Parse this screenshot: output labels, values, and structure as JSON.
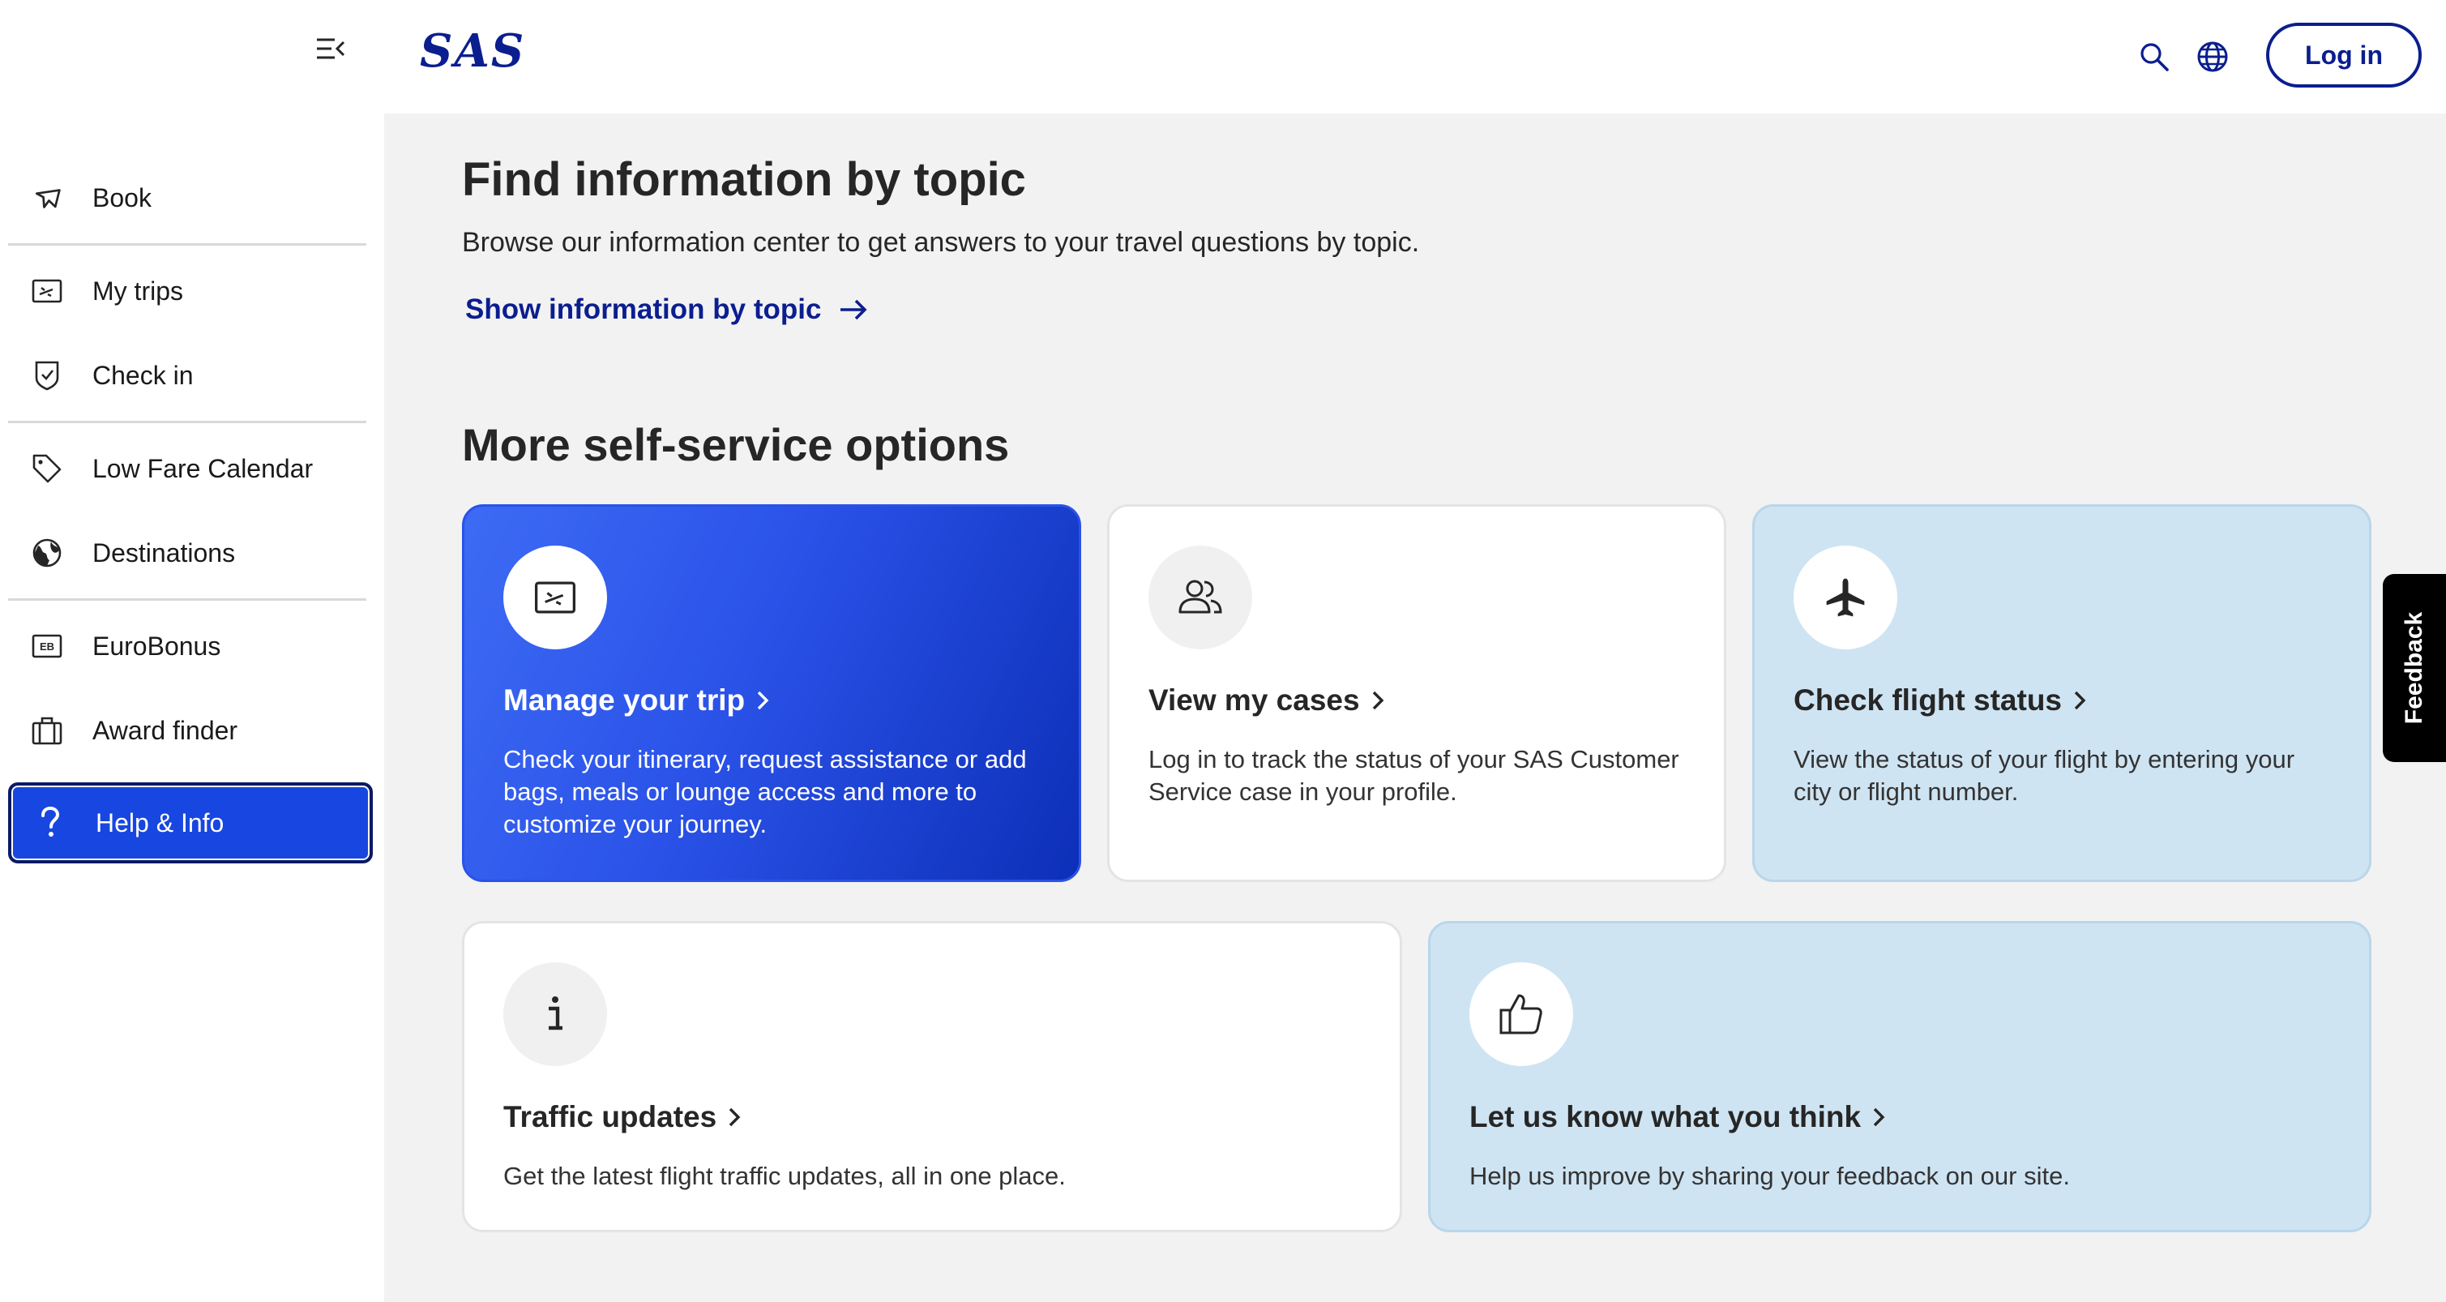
{
  "header": {
    "logo_text": "SAS",
    "login_label": "Log in",
    "icons": [
      "search-icon",
      "globe-icon"
    ]
  },
  "sidebar": {
    "collapse_icon": "menu-collapse-icon",
    "items": [
      {
        "label": "Book",
        "icon": "plane-icon"
      },
      {
        "label": "My trips",
        "icon": "ticket-icon"
      },
      {
        "label": "Check in",
        "icon": "shield-check-icon"
      },
      {
        "label": "Low Fare Calendar",
        "icon": "tag-icon"
      },
      {
        "label": "Destinations",
        "icon": "globe-icon"
      },
      {
        "label": "EuroBonus",
        "icon": "eb-card-icon"
      },
      {
        "label": "Award finder",
        "icon": "briefcase-icon"
      },
      {
        "label": "Help & Info",
        "icon": "question-icon",
        "active": true
      }
    ]
  },
  "main": {
    "heading": "Find information by topic",
    "description": "Browse our information center to get answers to your travel questions by topic.",
    "topic_link": "Show information by topic",
    "self_service_heading": "More self-service options",
    "cards": [
      {
        "title": "Manage your trip",
        "text": "Check your itinerary, request assistance or add bags, meals or lounge access and more to customize your journey.",
        "icon": "ticket-icon",
        "style": "blue-gradient"
      },
      {
        "title": "View my cases",
        "text": "Log in to track the status of your SAS Customer Service case in your profile.",
        "icon": "users-icon",
        "style": "white"
      },
      {
        "title": "Check flight status",
        "text": "View the status of your flight by entering your city or flight number.",
        "icon": "plane-icon",
        "style": "light-blue"
      },
      {
        "title": "Traffic updates",
        "text": "Get the latest flight traffic updates, all in one place.",
        "icon": "info-icon",
        "style": "white"
      },
      {
        "title": "Let us know what you think",
        "text": "Help us improve by sharing your feedback on our site.",
        "icon": "thumbs-up-icon",
        "style": "light-blue"
      }
    ]
  },
  "feedback_tab": "Feedback",
  "colors": {
    "brand_navy": "#0b1e8f",
    "active_blue": "#1846e0",
    "light_blue_card": "#cfe4f2",
    "page_bg": "#f2f2f2"
  }
}
